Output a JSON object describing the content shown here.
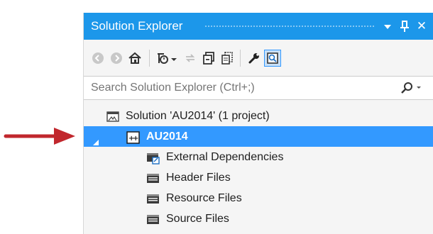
{
  "window": {
    "title": "Solution Explorer",
    "buttons": {
      "dropdown_icon": "dropdown-triangle",
      "pin_icon": "pin",
      "close_label": "✕"
    }
  },
  "toolbar": {
    "icons": [
      "back-arrow",
      "forward-arrow",
      "home",
      "pending-changes-filter",
      "sync-with-active-document",
      "collapse-all",
      "show-all-files",
      "properties-wrench",
      "preview-selected-items"
    ]
  },
  "search": {
    "placeholder": "Search Solution Explorer (Ctrl+;)",
    "icon": "search-magnifier"
  },
  "tree": {
    "solution": {
      "label": "Solution 'AU2014' (1 project)",
      "icon": "solution-icon"
    },
    "project": {
      "label": "AU2014",
      "icon": "cpp-project-icon",
      "expanded": true,
      "selected": true
    },
    "children": [
      {
        "label": "External Dependencies",
        "icon": "external-dependencies-icon"
      },
      {
        "label": "Header Files",
        "icon": "filter-folder-icon"
      },
      {
        "label": "Resource Files",
        "icon": "filter-folder-icon"
      },
      {
        "label": "Source Files",
        "icon": "filter-folder-icon"
      }
    ]
  },
  "colors": {
    "accent": "#1c97ea",
    "selection": "#3399ff",
    "panel_bg": "#f5f5f5",
    "annotation_arrow": "#c1272d"
  }
}
